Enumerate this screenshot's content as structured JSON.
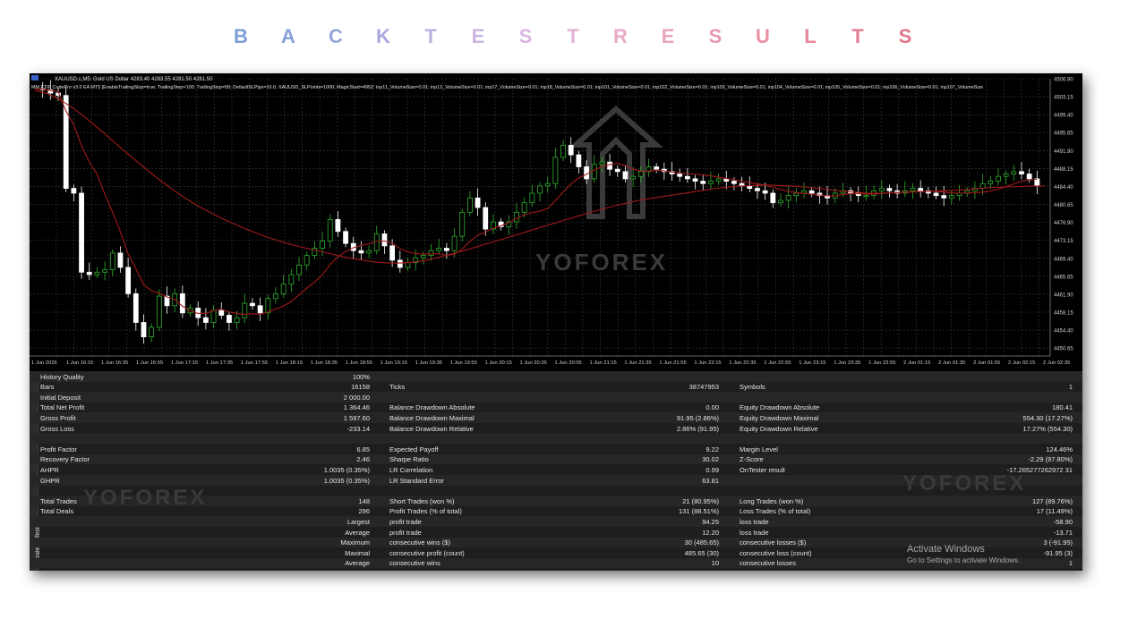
{
  "page_title_letters": [
    {
      "ch": "B",
      "color": "#7c9fd6"
    },
    {
      "ch": "A",
      "color": "#8aa0d8"
    },
    {
      "ch": "C",
      "color": "#98a6db"
    },
    {
      "ch": "K",
      "color": "#a8a8dc"
    },
    {
      "ch": "T",
      "color": "#bab0e0"
    },
    {
      "ch": "E",
      "color": "#cab4e0"
    },
    {
      "ch": "S",
      "color": "#d8b6df"
    },
    {
      "ch": "T",
      "color": "#e2b2d6"
    },
    {
      "ch": "R",
      "color": "#e6aac8"
    },
    {
      "ch": "E",
      "color": "#e8a4be"
    },
    {
      "ch": "S",
      "color": "#e898b0"
    },
    {
      "ch": "U",
      "color": "#e890a6"
    },
    {
      "ch": "L",
      "color": "#e6869c"
    },
    {
      "ch": "T",
      "color": "#e47e92"
    },
    {
      "ch": "S",
      "color": "#e2768a"
    }
  ],
  "chart": {
    "symbol_line": "XAUUSD.c,M5:  Gold US Dollar  4283.40 4283.55 4281.50 4281.50",
    "ea_line": "MM FTIP CodePro v3.0 EA MT5 [EnableTrailingStop=true; TrailingStep=100; TrailingStop=50; DefaultSLPips=10.0; XAUUSD_SLPoints=1000; MagicStart=4952; inp11_VolumeSize=0.01; inp12_VolumeSize=0.01; inp17_VolumeSize=0.01; inp18_VolumeSize=0.01; inp101_VolumeSize=0.01; inp102_VolumeSize=0.01; inp103_VolumeSize=0.01; inp104_VolumeSize=0.01; inp105_VolumeSize=0.01; inp106_VolumeSize=0.01; inp107_VolumeSize",
    "watermark": "YOFOREX",
    "price_labels": [
      "4506.90",
      "4503.15",
      "4499.40",
      "4495.65",
      "4491.90",
      "4488.15",
      "4484.40",
      "4480.65",
      "4476.90",
      "4473.15",
      "4469.40",
      "4465.65",
      "4461.90",
      "4458.15",
      "4454.40",
      "4450.65"
    ],
    "time_labels": [
      "1 Jun 2026",
      "1 Jun 16:15",
      "1 Jun 16:35",
      "1 Jun 16:55",
      "1 Jun 17:15",
      "1 Jun 17:35",
      "1 Jun 17:55",
      "1 Jun 18:15",
      "1 Jun 18:35",
      "1 Jun 18:55",
      "1 Jun 19:15",
      "1 Jun 19:35",
      "1 Jun 19:55",
      "1 Jun 20:15",
      "1 Jun 20:35",
      "1 Jun 20:55",
      "1 Jun 21:15",
      "1 Jun 21:35",
      "1 Jun 21:55",
      "1 Jun 22:15",
      "1 Jun 22:35",
      "1 Jun 22:55",
      "1 Jun 23:15",
      "1 Jun 23:35",
      "1 Jun 23:55",
      "2 Jun 01:15",
      "2 Jun 01:35",
      "2 Jun 01:55",
      "2 Jun 02:15",
      "2 Jun 02:35"
    ],
    "colors": {
      "bull": "#2fae2f",
      "bear": "#ffffff",
      "ma": "#a11a1a",
      "grid": "#3a3a3a",
      "text": "#cfcfcf"
    },
    "close_path": [
      4504.8,
      4504.6,
      4503.9,
      4503.4,
      4484.0,
      4483.0,
      4466.5,
      4466.0,
      4466.5,
      4467.0,
      4470.5,
      4467.5,
      4462.0,
      4456.0,
      4453.0,
      4455.0,
      4461.5,
      4459.5,
      4462.0,
      4458.0,
      4459.0,
      4457.0,
      4456.0,
      4458.5,
      4457.5,
      4456.0,
      4457.0,
      4460.0,
      4459.5,
      4458.0,
      4461.0,
      4462.0,
      4464.0,
      4466.0,
      4468.0,
      4470.0,
      4471.5,
      4473.0,
      4477.5,
      4475.0,
      4472.5,
      4471.0,
      4470.5,
      4471.0,
      4474.5,
      4472.0,
      4469.0,
      4467.5,
      4468.5,
      4469.5,
      4470.0,
      4471.0,
      4471.5,
      4471.0,
      4474.0,
      4479.0,
      4482.0,
      4480.0,
      4475.5,
      4477.0,
      4476.0,
      4477.0,
      4479.0,
      4481.0,
      4483.0,
      4484.5,
      4485.0,
      4490.5,
      4493.0,
      4491.0,
      4488.5,
      4486.0,
      4489.0,
      4489.5,
      4488.0,
      4487.5,
      4486.0,
      4486.5,
      4487.5,
      4488.5,
      4488.0,
      4487.5,
      4487.0,
      4486.5,
      4486.0,
      4485.5,
      4485.0,
      4485.5,
      4486.0,
      4485.5,
      4485.0,
      4484.5,
      4484.0,
      4483.5,
      4483.0,
      4481.0,
      4481.5,
      4482.5,
      4483.0,
      4483.5,
      4483.0,
      4482.5,
      4482.0,
      4483.0,
      4483.5,
      4483.0,
      4482.5,
      4482.5,
      4483.5,
      4484.0,
      4483.5,
      4483.0,
      4483.5,
      4484.0,
      4483.5,
      4483.0,
      4482.5,
      4482.0,
      4482.5,
      4483.0,
      4483.5,
      4484.0,
      4485.0,
      4485.5,
      4486.5,
      4487.0,
      4487.5,
      4487.0,
      4486.0,
      4484.5
    ],
    "ma_path": [
      4504.5,
      4503.8,
      4502.5,
      4500.8,
      4498.8,
      4496.6,
      4494.3,
      4492.0,
      4489.8,
      4487.6,
      4485.5,
      4483.6,
      4481.8,
      4480.2,
      4478.8,
      4477.5,
      4476.3,
      4475.2,
      4474.2,
      4473.3,
      4472.5,
      4471.8,
      4471.2,
      4470.6,
      4470.0,
      4469.4,
      4469.0,
      4468.6,
      4468.4,
      4468.4,
      4468.6,
      4469.0,
      4469.6,
      4470.3,
      4471.0,
      4471.8,
      4472.6,
      4473.4,
      4474.2,
      4475.0,
      4475.8,
      4476.6,
      4477.4,
      4478.2,
      4479.0,
      4479.7,
      4480.4,
      4481.0,
      4481.6,
      4482.0,
      4482.4,
      4482.8,
      4483.2,
      4483.6,
      4484.0,
      4484.3,
      4484.5,
      4484.6,
      4484.7,
      4484.6,
      4484.5,
      4484.3,
      4484.0,
      4483.7,
      4483.4,
      4483.2,
      4483.0,
      4483.0,
      4483.1,
      4483.2,
      4483.3,
      4483.4,
      4483.5,
      4483.6,
      4483.8,
      4484.0,
      4484.2,
      4484.3,
      4484.4,
      4484.5,
      4484.5
    ]
  },
  "report": {
    "vertical_tab_label": "Strategy Tester",
    "close_glyph": "✕",
    "rows": [
      {
        "l1": "History Quality",
        "v1": "100%",
        "l2": "",
        "v2": "",
        "l3": "",
        "v3": ""
      },
      {
        "l1": "Bars",
        "v1": "16158",
        "l2": "Ticks",
        "v2": "38747953",
        "l3": "Symbols",
        "v3": "1"
      },
      {
        "l1": "Initial Deposit",
        "v1": "2 000.00",
        "l2": "",
        "v2": "",
        "l3": "",
        "v3": ""
      },
      {
        "l1": "Total Net Profit",
        "v1": "1 364.46",
        "l2": "Balance Drawdown Absolute",
        "v2": "0.00",
        "l3": "Equity Drawdown Absolute",
        "v3": "180.41"
      },
      {
        "l1": "Gross Profit",
        "v1": "1 597.60",
        "l2": "Balance Drawdown Maximal",
        "v2": "91.95 (2.86%)",
        "l3": "Equity Drawdown Maximal",
        "v3": "554.30 (17.27%)"
      },
      {
        "l1": "Gross Loss",
        "v1": "-233.14",
        "l2": "Balance Drawdown Relative",
        "v2": "2.86% (91.95)",
        "l3": "Equity Drawdown Relative",
        "v3": "17.27% (554.30)"
      },
      {
        "l1": "",
        "v1": "",
        "l2": "",
        "v2": "",
        "l3": "",
        "v3": ""
      },
      {
        "l1": "Profit Factor",
        "v1": "6.85",
        "l2": "Expected Payoff",
        "v2": "9.22",
        "l3": "Margin Level",
        "v3": "124.46%"
      },
      {
        "l1": "Recovery Factor",
        "v1": "2.46",
        "l2": "Sharpe Ratio",
        "v2": "30.02",
        "l3": "Z-Score",
        "v3": "-2.29 (97.80%)"
      },
      {
        "l1": "AHPR",
        "v1": "1.0035 (0.35%)",
        "l2": "LR Correlation",
        "v2": "0.99",
        "l3": "OnTester result",
        "v3": "-17.265277262972 31"
      },
      {
        "l1": "GHPR",
        "v1": "1.0035 (0.35%)",
        "l2": "LR Standard Error",
        "v2": "63.81",
        "l3": "",
        "v3": ""
      },
      {
        "l1": "",
        "v1": "",
        "l2": "",
        "v2": "",
        "l3": "",
        "v3": ""
      },
      {
        "l1": "Total Trades",
        "v1": "148",
        "l2": "Short Trades (won %)",
        "v2": "21 (80.95%)",
        "l3": "Long Trades (won %)",
        "v3": "127 (89.76%)"
      },
      {
        "l1": "Total Deals",
        "v1": "296",
        "l2": "Profit Trades (% of total)",
        "v2": "131 (88.51%)",
        "l3": "Loss Trades (% of total)",
        "v3": "17 (11.49%)"
      },
      {
        "l1": "",
        "v1": "Largest",
        "l2": "profit trade",
        "v2": "94.25",
        "l3": "loss trade",
        "v3": "-58.90"
      },
      {
        "l1": "",
        "v1": "Average",
        "l2": "profit trade",
        "v2": "12.20",
        "l3": "loss trade",
        "v3": "-13.71"
      },
      {
        "l1": "",
        "v1": "Maximum",
        "l2": "consecutive wins ($)",
        "v2": "30 (485.65)",
        "l3": "consecutive losses ($)",
        "v3": "3 (-91.95)"
      },
      {
        "l1": "",
        "v1": "Maximal",
        "l2": "consecutive profit (count)",
        "v2": "485.65 (30)",
        "l3": "consecutive loss (count)",
        "v3": "-91.95 (3)"
      },
      {
        "l1": "",
        "v1": "Average",
        "l2": "consecutive wins",
        "v2": "10",
        "l3": "consecutive losses",
        "v3": "1"
      }
    ],
    "watermark": "YOFOREX",
    "activate_title": "Activate Windows",
    "activate_sub": "Go to Settings to activate Windows."
  }
}
